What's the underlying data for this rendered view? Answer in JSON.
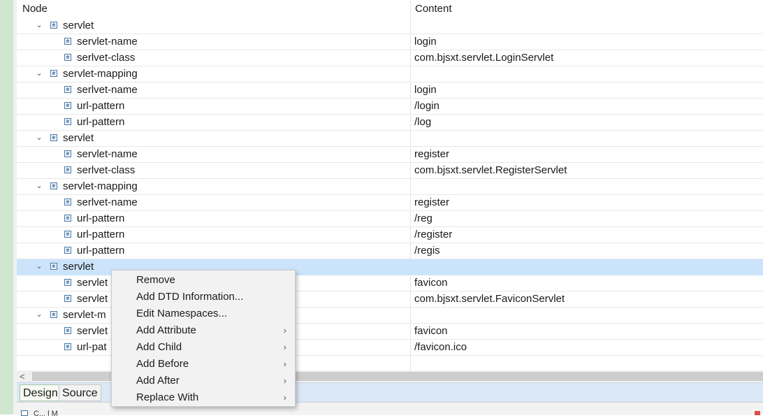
{
  "tree": {
    "headers": {
      "node": "Node",
      "content": "Content"
    },
    "rows": [
      {
        "node": "servlet",
        "content": "",
        "expand": "⌄",
        "level": 1
      },
      {
        "node": "servlet-name",
        "content": "login",
        "level": 2
      },
      {
        "node": "serlvet-class",
        "content": "com.bjsxt.servlet.LoginServlet",
        "level": 2
      },
      {
        "node": "servlet-mapping",
        "content": "",
        "expand": "⌄",
        "level": 1
      },
      {
        "node": "serlvet-name",
        "content": "login",
        "level": 2
      },
      {
        "node": "url-pattern",
        "content": "/login",
        "level": 2
      },
      {
        "node": "url-pattern",
        "content": "/log",
        "level": 2
      },
      {
        "node": "servlet",
        "content": "",
        "expand": "⌄",
        "level": 1
      },
      {
        "node": "servlet-name",
        "content": "register",
        "level": 2
      },
      {
        "node": "serlvet-class",
        "content": "com.bjsxt.servlet.RegisterServlet",
        "level": 2
      },
      {
        "node": "servlet-mapping",
        "content": "",
        "expand": "⌄",
        "level": 1
      },
      {
        "node": "serlvet-name",
        "content": "register",
        "level": 2
      },
      {
        "node": "url-pattern",
        "content": "/reg",
        "level": 2
      },
      {
        "node": "url-pattern",
        "content": "/register",
        "level": 2
      },
      {
        "node": "url-pattern",
        "content": "/regis",
        "level": 2
      },
      {
        "node": "servlet",
        "content": "",
        "expand": "⌄",
        "level": 1,
        "selected": true
      },
      {
        "node": "servlet",
        "content": "favicon",
        "level": 2
      },
      {
        "node": "servlet",
        "content": "com.bjsxt.servlet.FaviconServlet",
        "level": 2
      },
      {
        "node": "servlet-m",
        "content": "",
        "expand": "⌄",
        "level": 1
      },
      {
        "node": "servlet",
        "content": "favicon",
        "level": 2
      },
      {
        "node": "url-pat",
        "content": "/favicon.ico",
        "level": 2
      }
    ]
  },
  "element_icon_glyph": "e",
  "scrollbar": {
    "left_arrow": "<"
  },
  "tabs": [
    {
      "label": "Design",
      "active": true
    },
    {
      "label": "Source",
      "active": false
    }
  ],
  "bottom_panel": {
    "text": "C... l M"
  },
  "context_menu": {
    "items": [
      {
        "label": "Remove",
        "submenu": false
      },
      {
        "label": "Add DTD Information...",
        "submenu": false
      },
      {
        "label": "Edit Namespaces...",
        "submenu": false
      },
      {
        "label": "Add Attribute",
        "submenu": true
      },
      {
        "label": "Add Child",
        "submenu": true
      },
      {
        "label": "Add Before",
        "submenu": true
      },
      {
        "label": "Add After",
        "submenu": true
      },
      {
        "label": "Replace With",
        "submenu": true
      }
    ],
    "submenu_arrow": "›"
  },
  "colors": {
    "selection": "#cce4fb",
    "tabbar": "#dbe8f5",
    "menu_bg": "#f2f2f2",
    "left_strip": "#cfe7cf"
  }
}
